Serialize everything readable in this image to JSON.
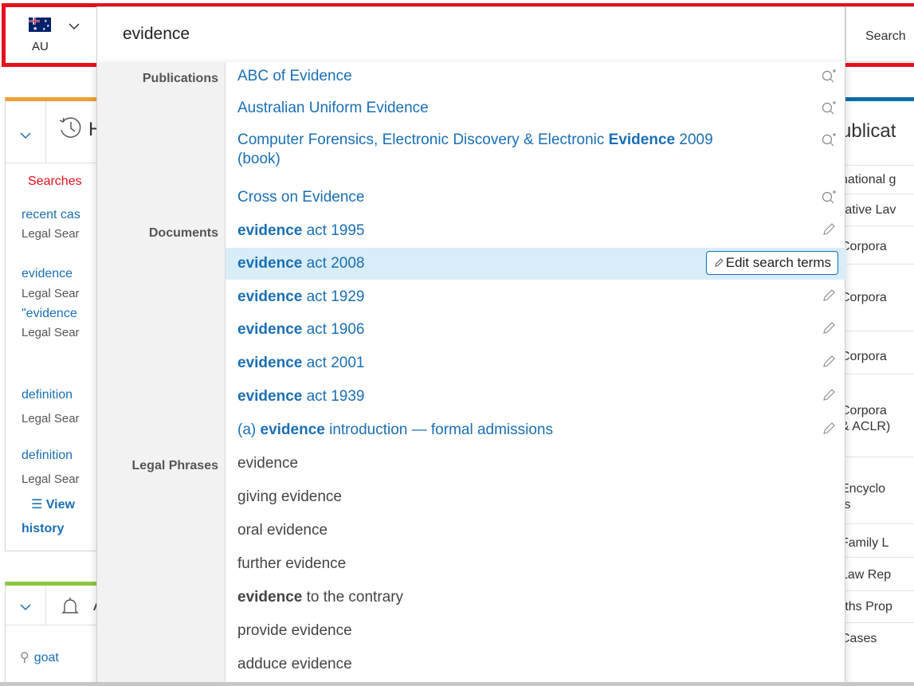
{
  "header": {
    "country_code": "AU",
    "search_value": "evidence",
    "search_button": "Search"
  },
  "left_panel": {
    "history_heading": "H",
    "tab": "Searches",
    "items": [
      {
        "title": "recent cas",
        "sub": "Legal Sear"
      },
      {
        "title": "evidence",
        "sub": "Legal Sear"
      },
      {
        "title": "\"evidence",
        "sub": "Legal Sear"
      },
      {
        "title": "definition",
        "sub": "Legal Sear"
      },
      {
        "title": "definition",
        "sub": "Legal Sear"
      }
    ],
    "view_label": "View",
    "history_label": "history"
  },
  "left_panel2": {
    "heading": "A",
    "query": "goat"
  },
  "right_panel": {
    "title": "ublicat",
    "rows": [
      "national g",
      "rative Lav",
      "Corpora",
      "Corpora",
      "Corpora",
      "Corpora",
      "& ACLR)",
      "Encyclo",
      "ts",
      "Family L",
      "Law Rep",
      "rths Prop",
      "Cases"
    ]
  },
  "dropdown": {
    "categories": {
      "publications": "Publications",
      "documents": "Documents",
      "legal_phrases": "Legal Phrases"
    },
    "publications": [
      {
        "pre": "ABC of Evidence",
        "bold": "",
        "post": ""
      },
      {
        "pre": "Australian Uniform Evidence",
        "bold": "",
        "post": ""
      },
      {
        "pre": "Computer Forensics, Electronic Discovery & Electronic ",
        "bold": "Evidence",
        "post": " 2009",
        "line2": "(book)"
      },
      {
        "pre": "Cross on Evidence",
        "bold": "",
        "post": ""
      }
    ],
    "documents": [
      {
        "bold": "evidence",
        "post": " act 1995"
      },
      {
        "bold": "evidence",
        "post": " act 2008"
      },
      {
        "bold": "evidence",
        "post": " act 1929"
      },
      {
        "bold": "evidence",
        "post": " act 1906"
      },
      {
        "bold": "evidence",
        "post": " act 2001"
      },
      {
        "bold": "evidence",
        "post": " act 1939"
      },
      {
        "pre": "(a) ",
        "bold": "evidence",
        "post": " introduction — formal admissions"
      }
    ],
    "edit_search_terms": "Edit search terms",
    "phrases": [
      {
        "pre": "evidence",
        "bold": "",
        "post": ""
      },
      {
        "pre": "giving evidence",
        "bold": "",
        "post": ""
      },
      {
        "pre": "oral evidence",
        "bold": "",
        "post": ""
      },
      {
        "pre": "further evidence",
        "bold": "",
        "post": ""
      },
      {
        "pre": "",
        "bold": "evidence",
        "post": " to the contrary"
      },
      {
        "pre": "provide evidence",
        "bold": "",
        "post": ""
      },
      {
        "pre": "adduce evidence",
        "bold": "",
        "post": ""
      }
    ]
  },
  "colors": {
    "highlight_frame": "#e3111b",
    "link": "#1a6fb4",
    "selected_row": "#d8edf8"
  }
}
